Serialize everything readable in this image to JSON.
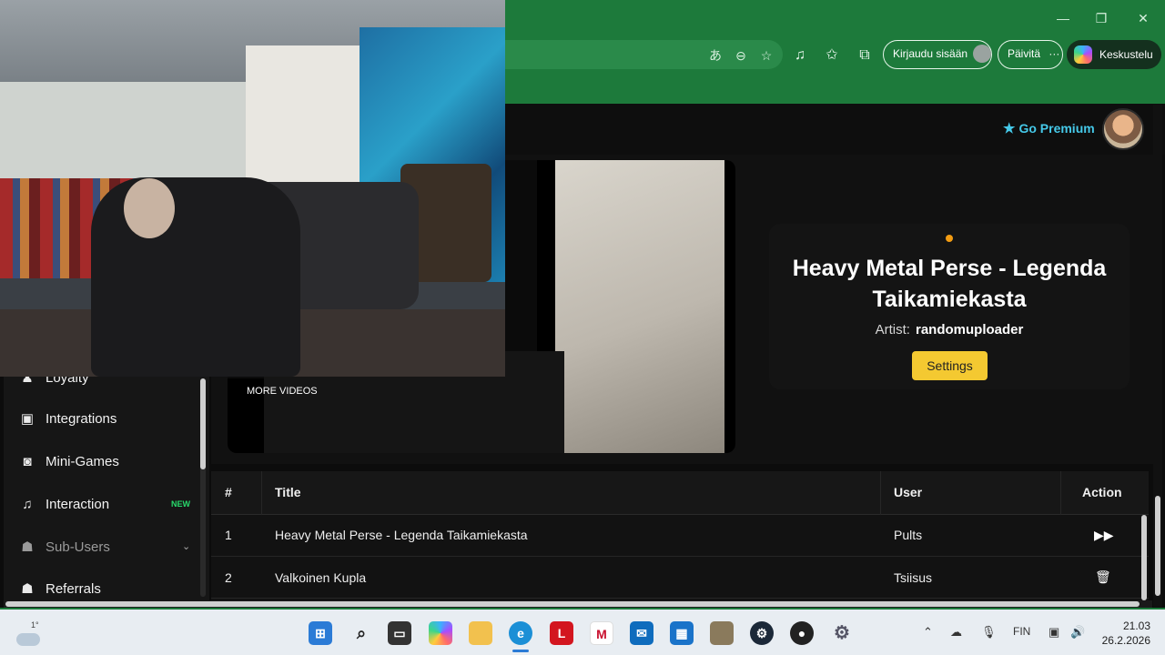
{
  "browser": {
    "win_controls": [
      "—",
      "❐",
      "✕"
    ],
    "signin_label": "Kirjaudu sisään",
    "update_label": "Päivitä",
    "update_more": "···",
    "copilot_label": "Keskustelu"
  },
  "header": {
    "premium_label": "Go Premium"
  },
  "player": {
    "more_videos": "MORE VIDEOS"
  },
  "now_playing": {
    "title": "Heavy Metal Perse - Legenda Taikamiekasta",
    "artist_label": "Artist:",
    "artist": "randomuploader",
    "settings_label": "Settings"
  },
  "sidebar": {
    "items": [
      {
        "label": "Loyalty",
        "icon": "user-icon"
      },
      {
        "label": "Integrations",
        "icon": "chat-icon"
      },
      {
        "label": "Mini-Games",
        "icon": "gamepad-icon"
      },
      {
        "label": "Interaction",
        "icon": "music-icon",
        "badge": "NEW"
      },
      {
        "label": "Sub-Users",
        "icon": "users-icon"
      },
      {
        "label": "Referrals",
        "icon": "users-icon"
      }
    ]
  },
  "queue": {
    "headers": [
      "#",
      "Title",
      "User",
      "Action"
    ],
    "rows": [
      {
        "num": "1",
        "title": "Heavy Metal Perse - Legenda Taikamiekasta",
        "user": "Pults",
        "action": "skip-icon"
      },
      {
        "num": "2",
        "title": "Valkoinen Kupla",
        "user": "Tsiisus",
        "action": "trash-icon"
      }
    ]
  },
  "taskbar": {
    "weather_temp": "1°",
    "language": "FIN",
    "time": "21.03",
    "date": "26.2.2026",
    "apps": [
      "windows",
      "search",
      "task-view",
      "copilot",
      "file-explorer",
      "edge",
      "L",
      "mcafee",
      "outlook",
      "store",
      "app",
      "steam",
      "obs",
      "settings"
    ]
  },
  "colors": {
    "browser_green": "#1d7a3b",
    "premium": "#45c9e9",
    "settings_button": "#f4c931",
    "new_badge": "#28d96b",
    "live_dot": "#f39c12"
  }
}
